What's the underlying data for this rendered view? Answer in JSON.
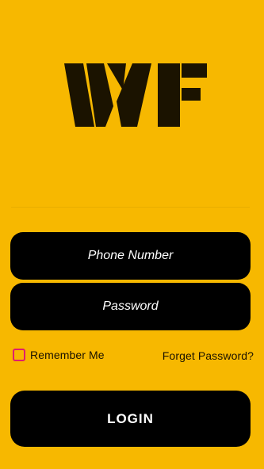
{
  "brand": {
    "logo_text": "WF",
    "background": "#F7B800",
    "accent": "#000000",
    "checkbox_color": "#E01E6C"
  },
  "form": {
    "phone_placeholder": "Phone Number",
    "password_placeholder": "Password",
    "remember_label": "Remember Me",
    "forgot_label": "Forget Password?",
    "login_label": "LOGIN",
    "remember_checked": false
  }
}
